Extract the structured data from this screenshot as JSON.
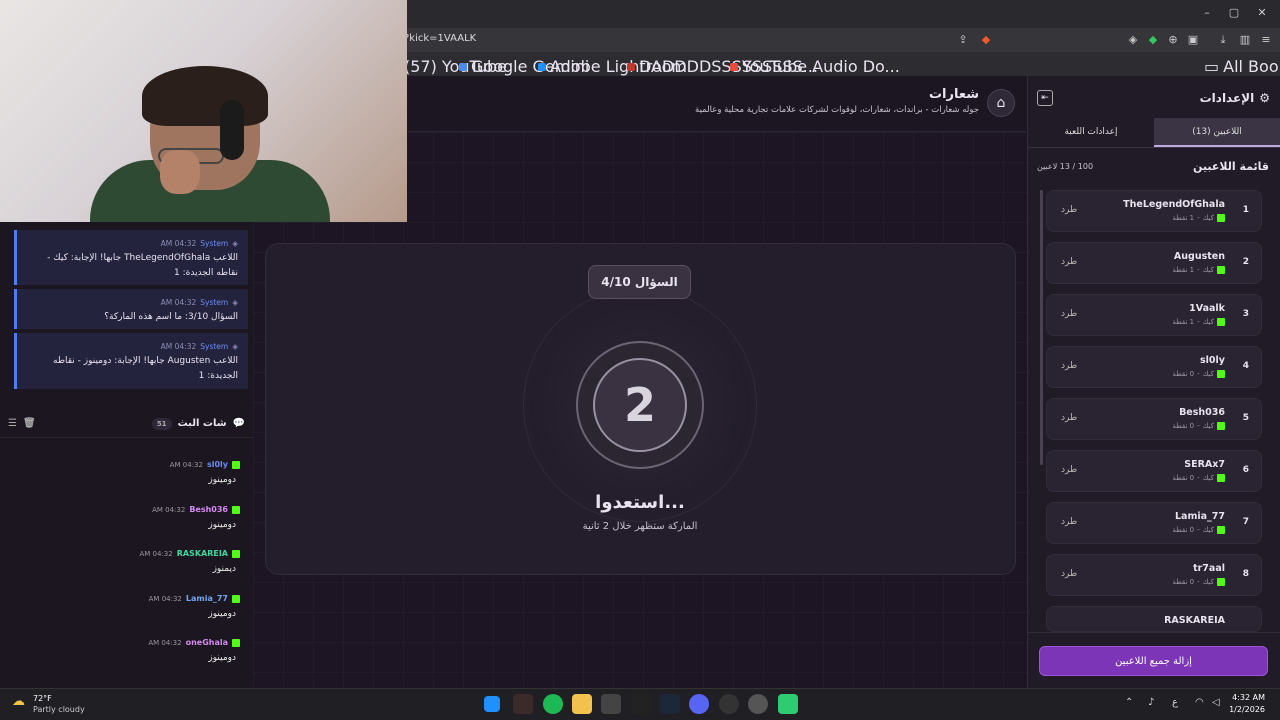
{
  "browser": {
    "url": "?kick=1VAALK",
    "bookmarks": [
      "(57) YouTube",
      "Google Gemini",
      "Adobe Lightroom",
      "DADDDDSSSSSSSSS...",
      "YouTube Audio Do..."
    ],
    "all_bookmarks": "All Bookmarks",
    "bookmark_colors": [
      "#cc0000",
      "#4a8af4",
      "#1e90ff",
      "#c0392b",
      "#e74c3c"
    ]
  },
  "left": {
    "system_messages": [
      {
        "name": "System",
        "time": "04:32 AM",
        "text": "اللاعب TheLegendOfGhala جابها! الإجابة: كيك - نقاطه الجديدة: 1"
      },
      {
        "name": "System",
        "time": "04:32 AM",
        "text": "السؤال 3/10: ما اسم هذه الماركة؟"
      },
      {
        "name": "System",
        "time": "04:32 AM",
        "text": "اللاعب Augusten جابها! الإجابة: دومينوز - نقاطه الجديدة: 1"
      }
    ],
    "chat_title": "شات البث",
    "chat_count": "51",
    "messages": [
      {
        "user": "sl0ly",
        "time": "04:32 AM",
        "text": "دومينوز",
        "color": "#6b8df2"
      },
      {
        "user": "Besh036",
        "time": "04:32 AM",
        "text": "دومينوز",
        "color": "#d68af0"
      },
      {
        "user": "RASKAREIA",
        "time": "04:32 AM",
        "text": "ديمنوز",
        "color": "#3fd6a0"
      },
      {
        "user": "Lamia_77",
        "time": "04:32 AM",
        "text": "دومينوز",
        "color": "#6fa6f2"
      },
      {
        "user": "oneGhala",
        "time": "04:32 AM",
        "text": "دومينوز",
        "color": "#d68af0"
      }
    ]
  },
  "main": {
    "title": "شعارات",
    "subtitle": "جوله شعارات - براندات، شعارات، لوقوات لشركات علامات تجارية محلية وعالمية",
    "question_badge": "السؤال 4/10",
    "countdown": "2",
    "ready": "استعدوا...",
    "ready_sub": "الماركة ستظهر خلال 2 ثانية"
  },
  "right": {
    "title": "الإعدادات",
    "tabs": [
      "اللاعبين (13)",
      "إعدادات اللعبة"
    ],
    "list_title": "قائمة اللاعبين",
    "list_count": "100 / 13 لاعبين",
    "kick_label": "طرد",
    "platform": "كيك",
    "players": [
      {
        "rank": "1",
        "name": "TheLegendOfGhala",
        "points": "1 نقطة"
      },
      {
        "rank": "2",
        "name": "Augusten",
        "points": "1 نقطة"
      },
      {
        "rank": "3",
        "name": "1Vaalk",
        "points": "1 نقطة"
      },
      {
        "rank": "4",
        "name": "sl0ly",
        "points": "0 نقطة"
      },
      {
        "rank": "5",
        "name": "Besh036",
        "points": "0 نقطة"
      },
      {
        "rank": "6",
        "name": "SERAx7",
        "points": "0 نقطة"
      },
      {
        "rank": "7",
        "name": "Lamia_77",
        "points": "0 نقطة"
      },
      {
        "rank": "8",
        "name": "tr7aal",
        "points": "0 نقطة"
      }
    ],
    "partial_player": "RASKAREIA",
    "remove_all": "إزالة جميع اللاعبين"
  },
  "taskbar": {
    "temp": "72°F",
    "weather": "Partly cloudy",
    "time": "4:32 AM",
    "date": "1/2/2026",
    "lang": "ع"
  }
}
